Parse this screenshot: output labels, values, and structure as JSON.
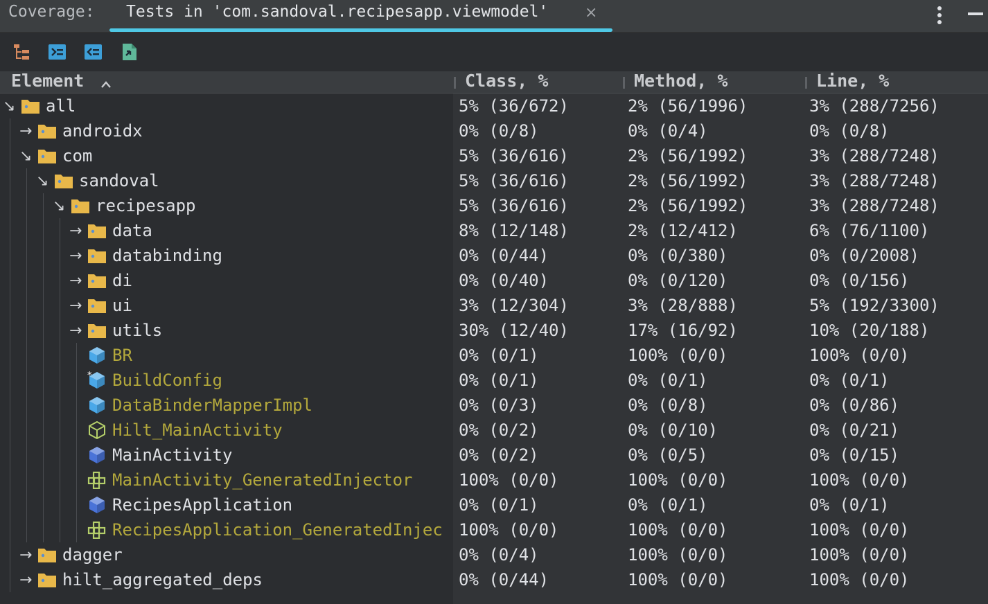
{
  "tabbar": {
    "prefix": "Coverage:",
    "tab_label": "Tests in 'com.sandoval.recipesapp.viewmodel'",
    "close_glyph": "×",
    "accent": "#4fc8e5"
  },
  "toolbar": {
    "buttons": [
      "flatten-packages-icon",
      "navigate-to-source-icon",
      "navigate-from-source-icon",
      "export-report-icon"
    ]
  },
  "header": {
    "element": "Element",
    "class": "Class, %",
    "method": "Method, %",
    "line": "Line, %"
  },
  "rows": [
    {
      "name": "all",
      "kind": "package",
      "level": 0,
      "arrow": "↘",
      "class": "5% (36/672)",
      "method": "2% (56/1996)",
      "line": "3% (288/7256)"
    },
    {
      "name": "androidx",
      "kind": "package",
      "level": 1,
      "arrow": "→",
      "class": "0% (0/8)",
      "method": "0% (0/4)",
      "line": "0% (0/8)"
    },
    {
      "name": "com",
      "kind": "package",
      "level": 1,
      "arrow": "↘",
      "class": "5% (36/616)",
      "method": "2% (56/1992)",
      "line": "3% (288/7248)"
    },
    {
      "name": "sandoval",
      "kind": "package",
      "level": 2,
      "arrow": "↘",
      "class": "5% (36/616)",
      "method": "2% (56/1992)",
      "line": "3% (288/7248)"
    },
    {
      "name": "recipesapp",
      "kind": "package",
      "level": 3,
      "arrow": "↘",
      "class": "5% (36/616)",
      "method": "2% (56/1992)",
      "line": "3% (288/7248)"
    },
    {
      "name": "data",
      "kind": "package",
      "level": 4,
      "arrow": "→",
      "class": "8% (12/148)",
      "method": "2% (12/412)",
      "line": "6% (76/1100)"
    },
    {
      "name": "databinding",
      "kind": "package",
      "level": 4,
      "arrow": "→",
      "class": "0% (0/44)",
      "method": "0% (0/380)",
      "line": "0% (0/2008)"
    },
    {
      "name": "di",
      "kind": "package",
      "level": 4,
      "arrow": "→",
      "class": "0% (0/40)",
      "method": "0% (0/120)",
      "line": "0% (0/156)"
    },
    {
      "name": "ui",
      "kind": "package",
      "level": 4,
      "arrow": "→",
      "class": "3% (12/304)",
      "method": "3% (28/888)",
      "line": "5% (192/3300)"
    },
    {
      "name": "utils",
      "kind": "package",
      "level": 4,
      "arrow": "→",
      "class": "30% (12/40)",
      "method": "17% (16/92)",
      "line": "10% (20/188)"
    },
    {
      "name": "BR",
      "kind": "class-light",
      "level": 4,
      "arrow": "",
      "untested": true,
      "class": "0% (0/1)",
      "method": "100% (0/0)",
      "line": "100% (0/0)"
    },
    {
      "name": "BuildConfig",
      "kind": "class-static",
      "level": 4,
      "arrow": "",
      "untested": true,
      "class": "0% (0/1)",
      "method": "0% (0/1)",
      "line": "0% (0/1)"
    },
    {
      "name": "DataBinderMapperImpl",
      "kind": "class-light",
      "level": 4,
      "arrow": "",
      "untested": true,
      "class": "0% (0/3)",
      "method": "0% (0/8)",
      "line": "0% (0/86)"
    },
    {
      "name": "Hilt_MainActivity",
      "kind": "class-abstract",
      "level": 4,
      "arrow": "",
      "untested": true,
      "class": "0% (0/2)",
      "method": "0% (0/10)",
      "line": "0% (0/21)"
    },
    {
      "name": "MainActivity",
      "kind": "class-dark",
      "level": 4,
      "arrow": "",
      "untested": false,
      "class": "0% (0/2)",
      "method": "0% (0/5)",
      "line": "0% (0/15)"
    },
    {
      "name": "MainActivity_GeneratedInjector",
      "kind": "interface",
      "level": 4,
      "arrow": "",
      "untested": true,
      "class": "100% (0/0)",
      "method": "100% (0/0)",
      "line": "100% (0/0)"
    },
    {
      "name": "RecipesApplication",
      "kind": "class-dark",
      "level": 4,
      "arrow": "",
      "untested": false,
      "class": "0% (0/1)",
      "method": "0% (0/1)",
      "line": "0% (0/1)"
    },
    {
      "name": "RecipesApplication_GeneratedInjec",
      "kind": "interface",
      "level": 4,
      "arrow": "",
      "untested": true,
      "class": "100% (0/0)",
      "method": "100% (0/0)",
      "line": "100% (0/0)"
    },
    {
      "name": "dagger",
      "kind": "package",
      "level": 1,
      "arrow": "→",
      "class": "0% (0/4)",
      "method": "100% (0/0)",
      "line": "100% (0/0)"
    },
    {
      "name": "hilt_aggregated_deps",
      "kind": "package",
      "level": 1,
      "arrow": "→",
      "class": "0% (0/44)",
      "method": "100% (0/0)",
      "line": "100% (0/0)"
    }
  ],
  "colors": {
    "folder": "#e8b84a",
    "class_light": "#4aa8e8",
    "class_dark": "#4a73d8",
    "interface": "#b5cf6a",
    "untested_text": "#b3a83c"
  }
}
